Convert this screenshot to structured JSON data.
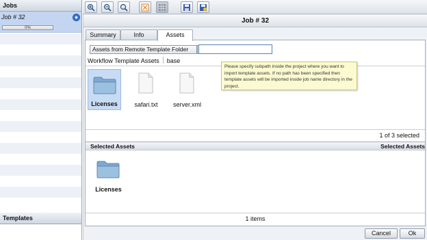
{
  "left_panel": {
    "jobs_header": "Jobs",
    "job": {
      "title": "Job # 32",
      "progress_text": "0%",
      "progress": 0
    },
    "templates_header": "Templates"
  },
  "toolbar": {
    "buttons": [
      "zoom-in-icon",
      "zoom-out-icon",
      "zoom-reset-icon",
      "fit-icon",
      "grid-icon",
      "save-icon",
      "save-all-icon"
    ]
  },
  "dialog": {
    "title": "Job # 32",
    "tabs": [
      {
        "label": "Summary",
        "active": false
      },
      {
        "label": "Info",
        "active": false
      },
      {
        "label": "Assets",
        "active": true
      }
    ],
    "source_select": "Assets from Remote Template Folder",
    "subpath_value": "",
    "breadcrumb": [
      "Workflow Template Assets",
      "base"
    ],
    "tooltip": "Please specify subpath inside the project where you want to import template assets. If no path has been specified then template assets will be imported inside job name directory in the project.",
    "assets": [
      {
        "label": "Licenses",
        "type": "folder",
        "selected": true
      },
      {
        "label": "safari.txt",
        "type": "file",
        "selected": false
      },
      {
        "label": "server.xml",
        "type": "file",
        "selected": false
      }
    ],
    "status_selected": "1 of 3 selected",
    "selected_header_left": "Selected Assets",
    "selected_header_right": "Selected Assets",
    "selected_assets": [
      {
        "label": "Licenses",
        "type": "folder"
      }
    ],
    "status_items": "1 items",
    "cancel_label": "Cancel",
    "ok_label": "Ok",
    "colors": {
      "selection": "#c8dbf5",
      "tooltip_bg": "#fbfad0",
      "job_row": "#c3d5f0"
    }
  }
}
